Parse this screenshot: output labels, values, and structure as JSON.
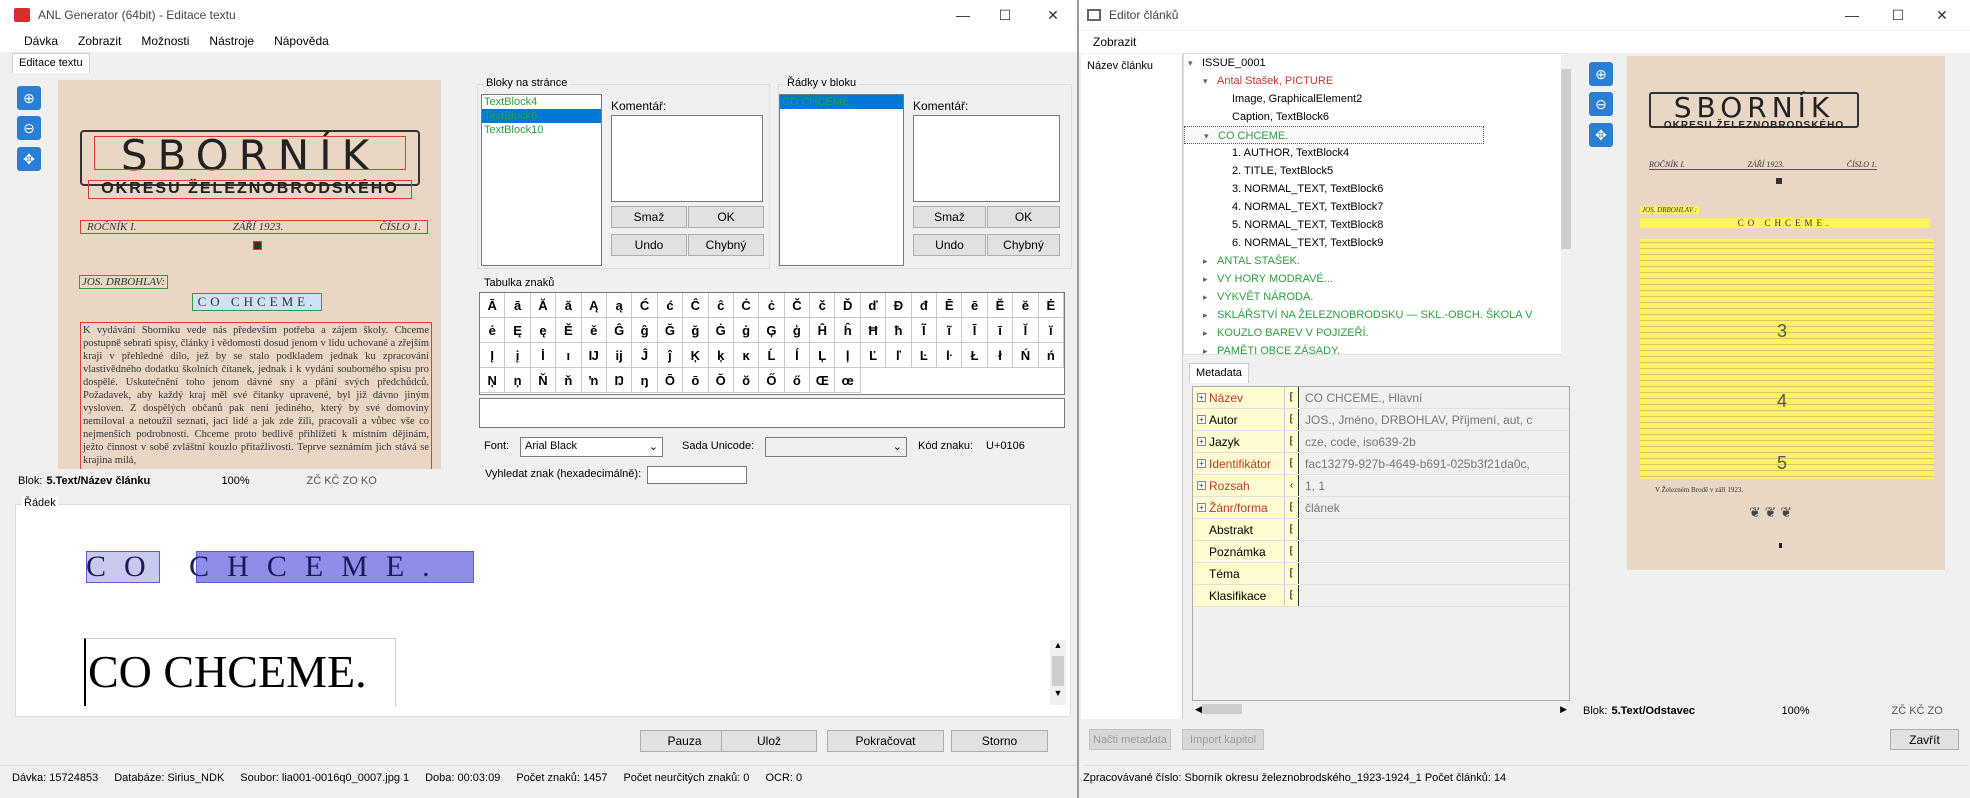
{
  "left_window": {
    "title": "ANL Generator (64bit) - Editace textu",
    "menu": [
      "Dávka",
      "Zobrazit",
      "Možnosti",
      "Nástroje",
      "Nápověda"
    ],
    "tab": "Editace textu",
    "doc": {
      "title": "SBORNÍK",
      "subtitle": "OKRESU ŽELEZNOBRODSKÉHO",
      "volume": "ROČNÍK I.",
      "date": "ZÁŘÍ 1923.",
      "number": "ČÍSLO 1.",
      "author": "JOS. DRBOHLAV:",
      "heading": "CO CHCEME.",
      "body": "K vydávání Sborníku vede nás především potřeba a zájem školy. Chceme postupně sebrati spisy, články i vědomosti dosud jenom v lidu uchované a zřejším kraji v přehledné dílo, jež by se stalo podkladem jednak ku zpracování vlastivědného dodatku školních čítanek, jednak i k vydání souborného spisu pro dospělé. Uskutečnění toho jenom dávné sny a přání svých předchůdců. Požadavek, aby každý kraj měl své čítanky upravené, byl již dávno jiným vysloven. Z dospělých občanů pak není jediného, který by své domoviny nemiloval a netoužil seznati, jací lidé a jak zde žili, pracovali a vůbec vše co nejmenších podrobností. Chceme proto bedlivě přihlížeti k místním dějinám, ježto činnost v sobě zvláštní kouzlo přitažlivosti. Teprve seznámím jich stává se krajina milá,"
    },
    "status_blok": "Blok:",
    "status_blok_val": "5.Text/Název článku",
    "zoom": "100%",
    "status_codes": "ZČ KČ ZO KO",
    "blocks_group": "Bloky na stránce",
    "blocks": [
      "TextBlock4",
      "TextBlock6",
      "TextBlock10"
    ],
    "komentar": "Komentář:",
    "btn_smaz": "Smaž",
    "btn_ok": "OK",
    "btn_undo": "Undo",
    "btn_chybny": "Chybný",
    "lines_group": "Řádky v bloku",
    "lines": [
      "CO CHCEME."
    ],
    "chars_group": "Tabulka znaků",
    "chars": [
      "Ā",
      "ā",
      "Ă",
      "ă",
      "Ą",
      "ą",
      "Ć",
      "ć",
      "Ĉ",
      "ĉ",
      "Ċ",
      "ċ",
      "Č",
      "č",
      "Ď",
      "ď",
      "Đ",
      "đ",
      "Ē",
      "ē",
      "Ĕ",
      "ĕ",
      "Ė",
      "ė",
      "Ę",
      "ę",
      "Ě",
      "ě",
      "Ĝ",
      "ĝ",
      "Ğ",
      "ğ",
      "Ġ",
      "ġ",
      "Ģ",
      "ģ",
      "Ĥ",
      "ĥ",
      "Ħ",
      "ħ",
      "Ĩ",
      "ĩ",
      "Ī",
      "ī",
      "Ĭ",
      "ĭ",
      "Į",
      "į",
      "İ",
      "ı",
      "Ĳ",
      "ĳ",
      "Ĵ",
      "ĵ",
      "Ķ",
      "ķ",
      "ĸ",
      "Ĺ",
      "ĺ",
      "Ļ",
      "ļ",
      "Ľ",
      "ľ",
      "Ŀ",
      "ŀ",
      "Ł",
      "ł",
      "Ń",
      "ń",
      "Ņ",
      "ņ",
      "Ň",
      "ň",
      "ŉ",
      "Ŋ",
      "ŋ",
      "Ō",
      "ō",
      "Ŏ",
      "ŏ",
      "Ő",
      "ő",
      "Œ",
      "œ"
    ],
    "font_label": "Font:",
    "font_value": "Arial Black",
    "unicode_label": "Sada Unicode:",
    "unicode_value": "",
    "code_label": "Kód znaku:",
    "code_value": "U+0106",
    "hex_label": "Vyhledat znak (hexadecimálně):",
    "radek_group": "Řádek",
    "radek_image_text": "CO CHCEME.",
    "radek_text": "CO CHCEME.",
    "btn_pauza": "Pauza",
    "btn_uloz": "Ulož",
    "btn_pokracovat": "Pokračovat",
    "btn_storno": "Storno",
    "status": {
      "davka": "Dávka: 15724853",
      "databaze": "Databáze: Sirius_NDK",
      "soubor": "Soubor:  lia001-0016q0_0007.jpg  1",
      "doba": "Doba: 00:03:09",
      "pocet": "Počet znaků: 1457",
      "neurcitych": "Počet neurčitých znaků: 0",
      "ocr": "OCR:  0"
    }
  },
  "right_window": {
    "title": "Editor článků",
    "menu": [
      "Zobrazit"
    ],
    "nazev_clanku": "Název článku",
    "tree": [
      {
        "text": "ISSUE_0001",
        "indent": 0,
        "color": "#000",
        "exp": "▾"
      },
      {
        "text": "Antal Stašek, PICTURE",
        "indent": 1,
        "color": "#c0392b",
        "exp": "▾"
      },
      {
        "text": "Image, GraphicalElement2",
        "indent": 2,
        "color": "#000",
        "exp": ""
      },
      {
        "text": "Caption, TextBlock6",
        "indent": 2,
        "color": "#000",
        "exp": ""
      },
      {
        "text": "CO CHCEME.",
        "indent": 1,
        "color": "#2e9e3f",
        "exp": "▾",
        "selected": true
      },
      {
        "text": "1. AUTHOR, TextBlock4",
        "indent": 2,
        "color": "#000",
        "exp": ""
      },
      {
        "text": "2. TITLE, TextBlock5",
        "indent": 2,
        "color": "#000",
        "exp": ""
      },
      {
        "text": "3. NORMAL_TEXT, TextBlock6",
        "indent": 2,
        "color": "#000",
        "exp": ""
      },
      {
        "text": "4. NORMAL_TEXT, TextBlock7",
        "indent": 2,
        "color": "#000",
        "exp": ""
      },
      {
        "text": "5. NORMAL_TEXT, TextBlock8",
        "indent": 2,
        "color": "#000",
        "exp": ""
      },
      {
        "text": "6. NORMAL_TEXT, TextBlock9",
        "indent": 2,
        "color": "#000",
        "exp": ""
      },
      {
        "text": "ANTAL STAŠEK.",
        "indent": 1,
        "color": "#2e9e3f",
        "exp": "▸"
      },
      {
        "text": "VY HORY MODRAVÉ...",
        "indent": 1,
        "color": "#2e9e3f",
        "exp": "▸"
      },
      {
        "text": "VÝKVĚT NÁRODA.",
        "indent": 1,
        "color": "#2e9e3f",
        "exp": "▸"
      },
      {
        "text": "SKLÁŘSTVÍ NA ŽELEZNOBRODSKU — SKL.-OBCH. ŠKOLA V",
        "indent": 1,
        "color": "#2e9e3f",
        "exp": "▸"
      },
      {
        "text": "KOUZLO BAREV V POJIZEŘÍ.",
        "indent": 1,
        "color": "#2e9e3f",
        "exp": "▸"
      },
      {
        "text": "PAMĚTI OBCE ZÁSADY.",
        "indent": 1,
        "color": "#2e9e3f",
        "exp": "▸"
      }
    ],
    "metadata_tab": "Metadata",
    "metadata": [
      {
        "key": "Název",
        "value": "CO CHCEME., Hlavní",
        "plus": true,
        "red": true
      },
      {
        "key": "Autor",
        "value": "JOS., Jméno, DRBOHLAV, Příjmení, aut, c",
        "plus": true,
        "red": false
      },
      {
        "key": "Jazyk",
        "value": "cze, code, iso639-2b",
        "plus": true,
        "red": false
      },
      {
        "key": "Identifikátor",
        "value": "fac13279-927b-4649-b691-025b3f21da0c,",
        "plus": true,
        "red": true
      },
      {
        "key": "Rozsah",
        "value": "1, 1",
        "plus": true,
        "red": true
      },
      {
        "key": "Žánr/forma",
        "value": "článek",
        "plus": true,
        "red": true
      },
      {
        "key": "Abstrakt",
        "value": "",
        "plus": false,
        "red": false
      },
      {
        "key": "Poznámka",
        "value": "",
        "plus": false,
        "red": false
      },
      {
        "key": "Téma",
        "value": "",
        "plus": false,
        "red": false
      },
      {
        "key": "Klasifikace",
        "value": "",
        "plus": false,
        "red": false
      }
    ],
    "btn_nacti": "Načti metadata",
    "btn_import": "Import kapitol",
    "status_blok": "Blok:",
    "status_blok_val": "5.Text/Odstavec",
    "zoom": "100%",
    "status_codes": "ZČ KČ ZO",
    "btn_zavrit": "Zavřít",
    "zpracovane": "Zpracovávané číslo:  Sborník okresu železnobrodského_1923-1924_1  Počet článků: 14",
    "doc": {
      "title": "SBORNÍK",
      "subtitle": "OKRESU ŽELEZNOBRODSKÉHO",
      "volume": "ROČNÍK I.",
      "date": "ZÁŘÍ 1923.",
      "number": "ČÍSLO 1.",
      "author": "JOS. DRBOHLAV :",
      "heading": "CO CHCEME.",
      "label3": "3",
      "label4": "4",
      "label5": "5",
      "sign": "V Železném Brodě v září 1923.",
      "ornament": "❦ ❦ ❦"
    }
  }
}
